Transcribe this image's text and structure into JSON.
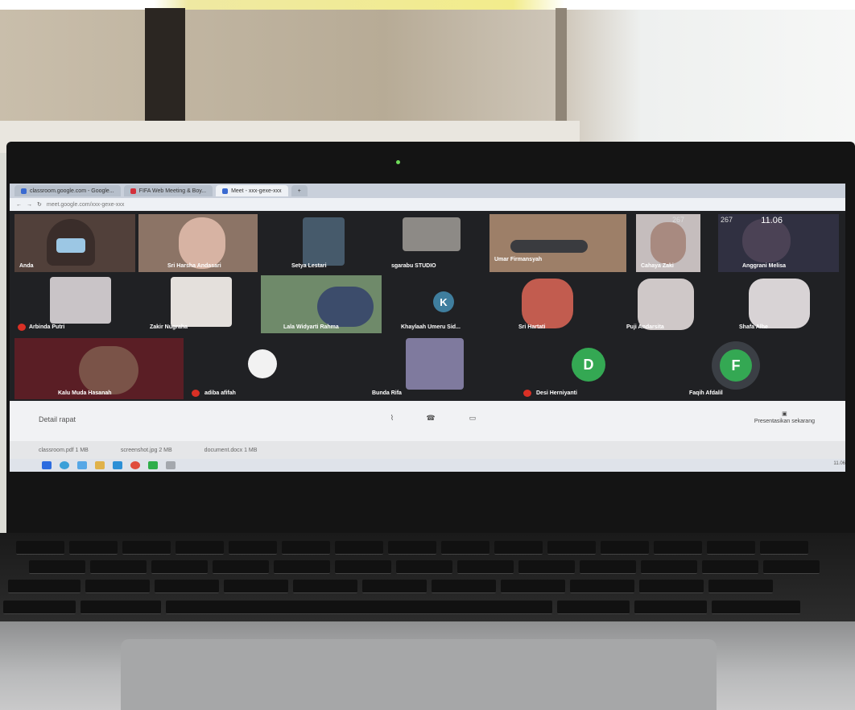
{
  "browser": {
    "tabs": [
      {
        "label": "classroom.google.com - Google..."
      },
      {
        "label": "FIFA Web Meeting & Boy..."
      },
      {
        "label": "Meet - xxx-gexe-xxx"
      }
    ],
    "url": "meet.google.com/xxx-gexe-xxx"
  },
  "status": {
    "time": "11.06",
    "stat1": "267",
    "stat2": "267"
  },
  "participants": [
    {
      "name": "Anda"
    },
    {
      "name": "Sri Harsha Andasari"
    },
    {
      "name": "Setya Lestari"
    },
    {
      "name": "sgarabu STUDIO"
    },
    {
      "name": "Umar Firmansyah"
    },
    {
      "name": "Cahaya Zaki"
    },
    {
      "name": "Anggrani Melisa"
    },
    {
      "name": "Arbinda Putri"
    },
    {
      "name": "Zakir Nugraha"
    },
    {
      "name": "Lala Widyarti Rahma"
    },
    {
      "name": "Khaylaah Umeru Sid...",
      "initial": "K"
    },
    {
      "name": "Sri Hartati"
    },
    {
      "name": "Puji Andarsita"
    },
    {
      "name": "Shafa Alhe"
    },
    {
      "name": "Kalu Muda Hasanah"
    },
    {
      "name": "adiba afifah"
    },
    {
      "name": "Bunda Rifa"
    },
    {
      "name": "Desi Herniyanti",
      "initial": "D"
    },
    {
      "name": "Faqih Afdalil",
      "initial": "F"
    }
  ],
  "controls": {
    "details": "Detail rapat",
    "present": "Presentasikan sekarang"
  },
  "downloads": [
    "classroom.pdf 1 MB",
    "screenshot.jpg 2 MB",
    "document.docx 1 MB"
  ],
  "taskbar": {
    "tray_time": "11.06"
  },
  "colors": {
    "meet_bg": "#202124",
    "mic_off": "#d93025",
    "avatar_green": "#34a853",
    "avatar_blue": "#1a73e8"
  }
}
